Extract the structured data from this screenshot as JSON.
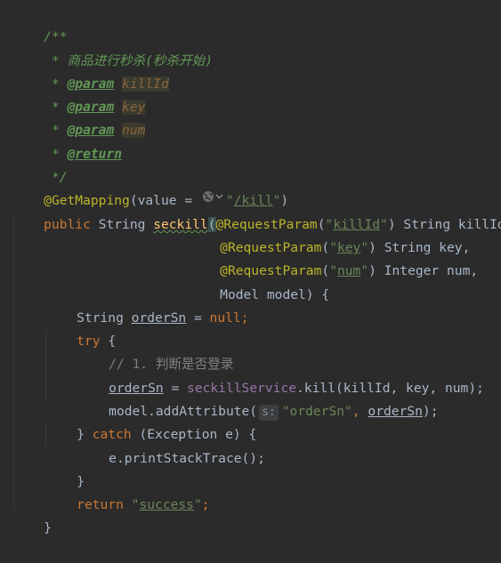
{
  "code": {
    "l1": "/**",
    "l2": " * 商品进行秒杀(秒杀开始)",
    "l3_star": " * ",
    "l3_tag": "@param",
    "l3_name": "killId",
    "l4_star": " * ",
    "l4_tag": "@param",
    "l4_name": "key",
    "l5_star": " * ",
    "l5_tag": "@param",
    "l5_name": "num",
    "l6_star": " * ",
    "l6_tag": "@return",
    "l7": " */",
    "l8_ann": "@GetMapping",
    "l8_open": "(value = ",
    "l8_str_q1": "\"",
    "l8_str": "/kill",
    "l8_str_q2": "\"",
    "l8_close": ")",
    "l9_kw": "public ",
    "l9_type": "String ",
    "l9_method": "seckill",
    "l9_p1": "(",
    "l9_ann": "@RequestParam",
    "l9_p2": "(",
    "l9_q1": "\"",
    "l9_str": "killId",
    "l9_q2": "\"",
    "l9_rest": ") String killId,",
    "l10_ann": "@RequestParam",
    "l10_p": "(",
    "l10_q1": "\"",
    "l10_str": "key",
    "l10_q2": "\"",
    "l10_rest": ") String key,",
    "l11_ann": "@RequestParam",
    "l11_p": "(",
    "l11_q1": "\"",
    "l11_str": "num",
    "l11_q2": "\"",
    "l11_rest": ") Integer num,",
    "l12_text": "Model model) ",
    "l12_brace": "{",
    "l13_type": "String ",
    "l13_var": "orderSn",
    "l13_eq": " = ",
    "l13_null": "null",
    "l13_semi": ";",
    "l14_try": "try ",
    "l14_brace": "{",
    "l15_comment": "// 1. 判断是否登录",
    "l16_var": "orderSn",
    "l16_eq": " = ",
    "l16_svc": "seckillService",
    "l16_rest": ".kill(killId, key, num);",
    "l17_a": "model.addAttribute(",
    "l17_hint": "s:",
    "l17_str": "\"orderSn\"",
    "l17_comma": ", ",
    "l17_var": "orderSn",
    "l17_end": ");",
    "l18_close": "} ",
    "l18_catch": "catch ",
    "l18_mid": "(Exception e) ",
    "l18_brace": "{",
    "l19": "e.printStackTrace();",
    "l20": "}",
    "l21_ret": "return ",
    "l21_q1": "\"",
    "l21_str": "success",
    "l21_q2": "\"",
    "l21_semi": ";",
    "l22": "}"
  },
  "colors": {
    "background": "#2b2b2b",
    "keyword": "#cc7832",
    "annotation": "#bbb529",
    "string": "#6a8759",
    "doc_comment": "#629755",
    "line_comment": "#808080",
    "method_declaration": "#ffc66d",
    "field": "#9876aa",
    "default_text": "#a9b7c6"
  },
  "icons": {
    "url_hint": "globe-icon"
  }
}
